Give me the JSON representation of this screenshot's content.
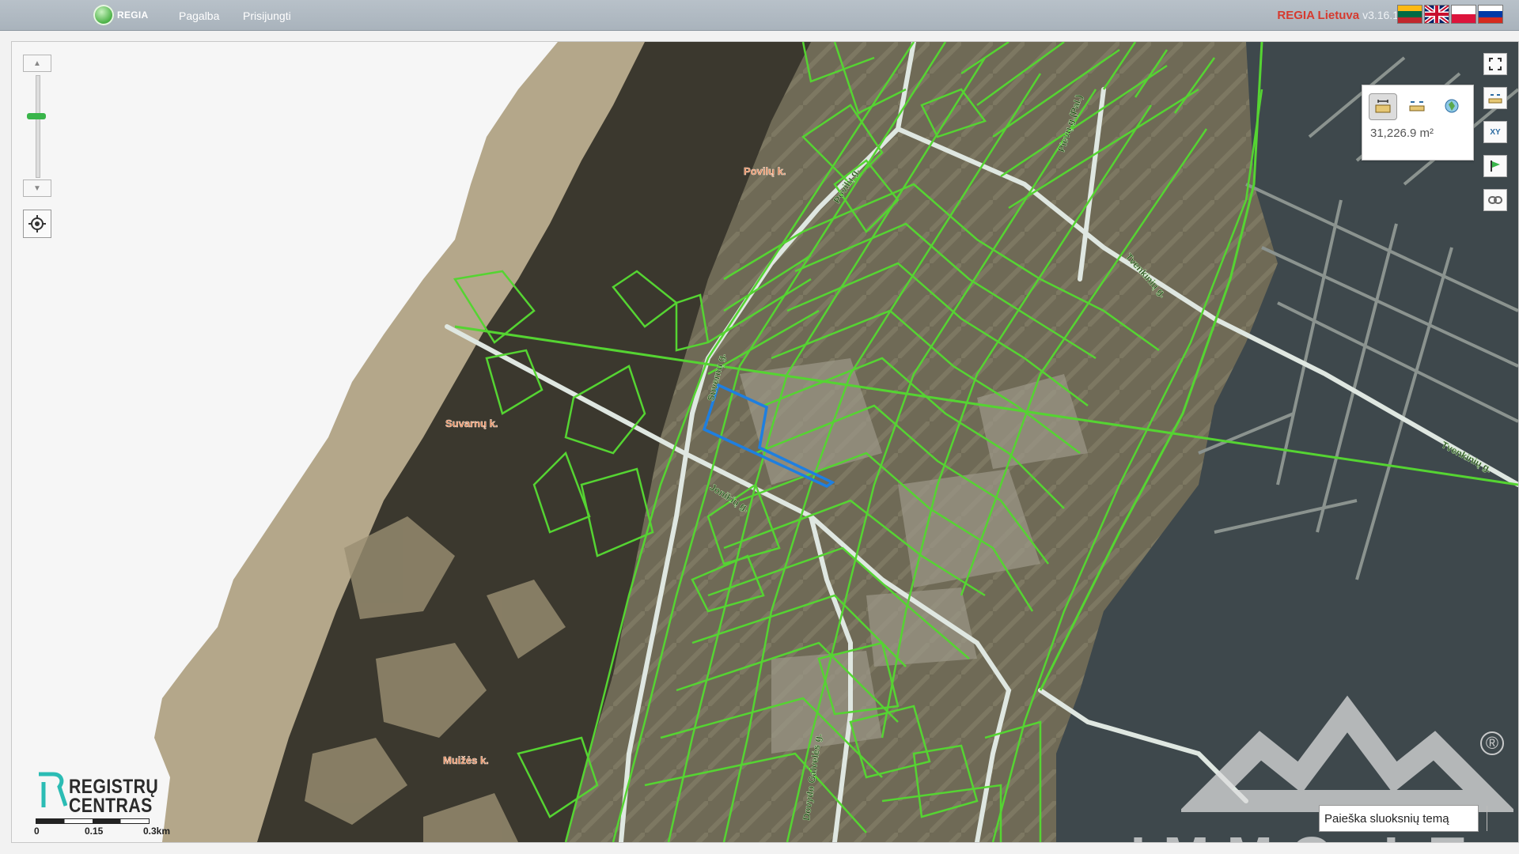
{
  "app": {
    "logo_text": "REGIA",
    "nav": [
      "Pagalba",
      "Prisijungti"
    ],
    "brand_name": "REGIA Lietuva",
    "version": "v3.16.1",
    "languages": [
      "lt",
      "en",
      "pl",
      "ru"
    ]
  },
  "map": {
    "place_labels": [
      "Povilų k.",
      "Suvarnų k.",
      "Muižės k."
    ],
    "street_labels": [
      "Povilų g.",
      "Pievų g.(Pal.)",
      "Tvenkinių g.",
      "Suvernų g.",
      "Jonikių g.",
      "Dovydo Galvelės g.",
      "Tvenkinių g."
    ],
    "zoom_level_fraction": 0.45,
    "colors": {
      "parcel_outline": "#55d432",
      "road": "#dfe7e1",
      "selected_parcel": "#1e7fe0",
      "water": "#3f4a4e",
      "forest": "#3d3a2f",
      "dune": "#b7aa8d"
    }
  },
  "measure": {
    "tools": [
      "area-measure-icon",
      "distance-measure-icon",
      "location-measure-icon"
    ],
    "value": "31,226.9 m²"
  },
  "tools": [
    "fullscreen-icon",
    "measure-toggle-icon",
    "coordinates-icon",
    "flag-icon",
    "link-icon"
  ],
  "tool_labels": {
    "coords": "XY"
  },
  "footer": {
    "logo_lines": [
      "REGISTRŲ",
      "CENTRAS"
    ],
    "scale_ticks": [
      "0",
      "0.15",
      "0.3km"
    ],
    "layer_search_value": "Paieška sluoksnių temą"
  },
  "watermark": {
    "text": "IMMO.LT",
    "registered": "®"
  }
}
